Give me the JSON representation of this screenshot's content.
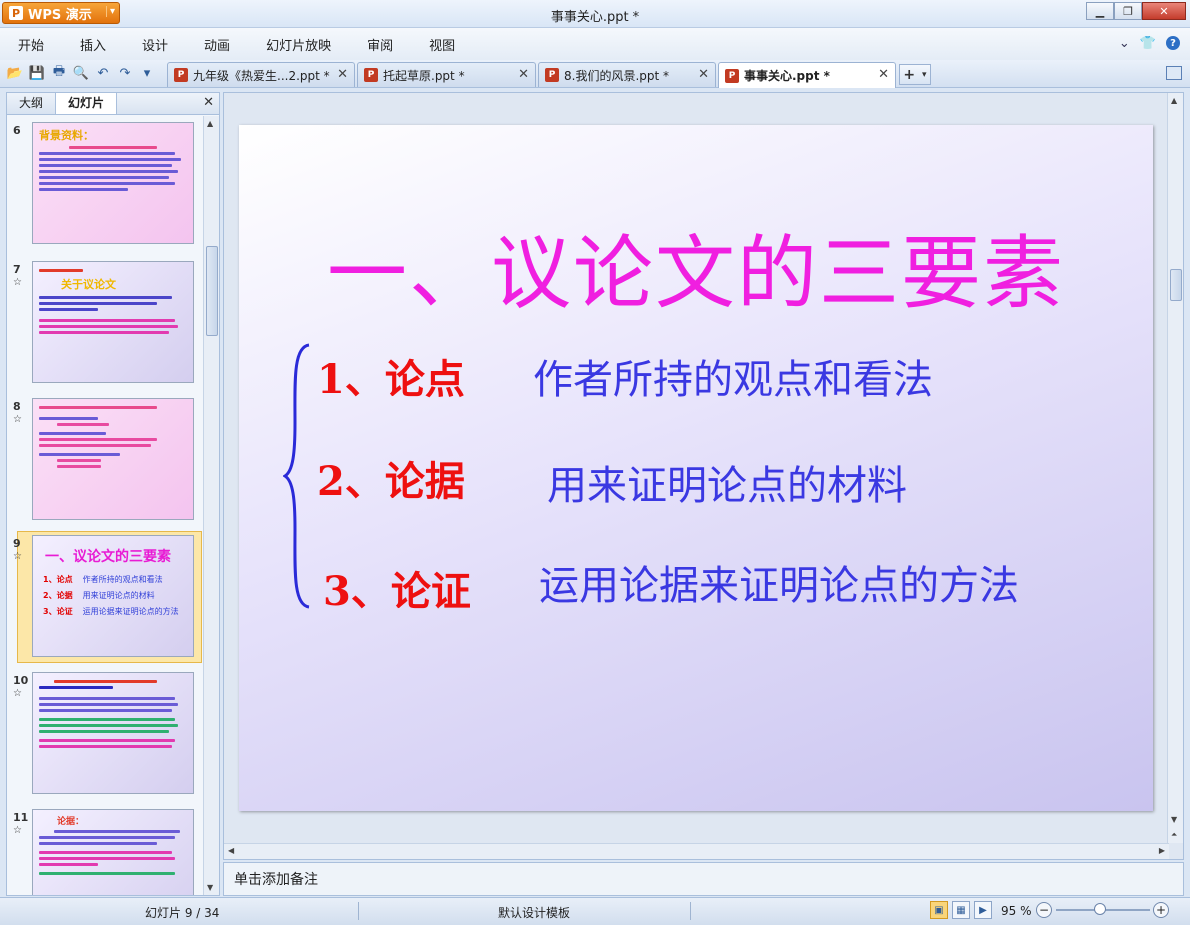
{
  "app": {
    "button_label": "WPS 演示",
    "window_title": "事事关心.ppt *"
  },
  "menu": [
    "开始",
    "插入",
    "设计",
    "动画",
    "幻灯片放映",
    "审阅",
    "视图"
  ],
  "tabs": [
    {
      "label": "九年级《热爱生...2.ppt *"
    },
    {
      "label": "托起草原.ppt *"
    },
    {
      "label": "8.我们的风景.ppt *"
    },
    {
      "label": "事事关心.ppt *"
    }
  ],
  "left_panel": {
    "tabs": [
      "大纲",
      "幻灯片"
    ],
    "slides": [
      {
        "number": "6",
        "title": "背景资料："
      },
      {
        "number": "7",
        "title": "关于议论文"
      },
      {
        "number": "8",
        "title": ""
      },
      {
        "number": "9",
        "title": "一、议论文的三要素",
        "rows": [
          {
            "point": "1、论点",
            "desc": "作者所持的观点和看法"
          },
          {
            "point": "2、论据",
            "desc": "用来证明论点的材料"
          },
          {
            "point": "3、论证",
            "desc": "运用论据来证明论点的方法"
          }
        ]
      },
      {
        "number": "10",
        "title": ""
      },
      {
        "number": "11",
        "title": "论据："
      }
    ]
  },
  "slide": {
    "title": "一、议论文的三要素",
    "items": [
      {
        "point": "1、论点",
        "desc": "作者所持的观点和看法"
      },
      {
        "point": "2、论据",
        "desc": "用来证明论点的材料"
      },
      {
        "point": "3、论证",
        "desc": "运用论据来证明论点的方法"
      }
    ]
  },
  "notes": {
    "placeholder": "单击添加备注"
  },
  "status": {
    "slides": "幻灯片 9 / 34",
    "template": "默认设计模板",
    "zoom": "95 %"
  },
  "colors": {
    "title_magenta": "#f01fe0",
    "point_red": "#ee1010",
    "desc_blue": "#3a38e2",
    "selected_thumb": "#fce7a8"
  }
}
